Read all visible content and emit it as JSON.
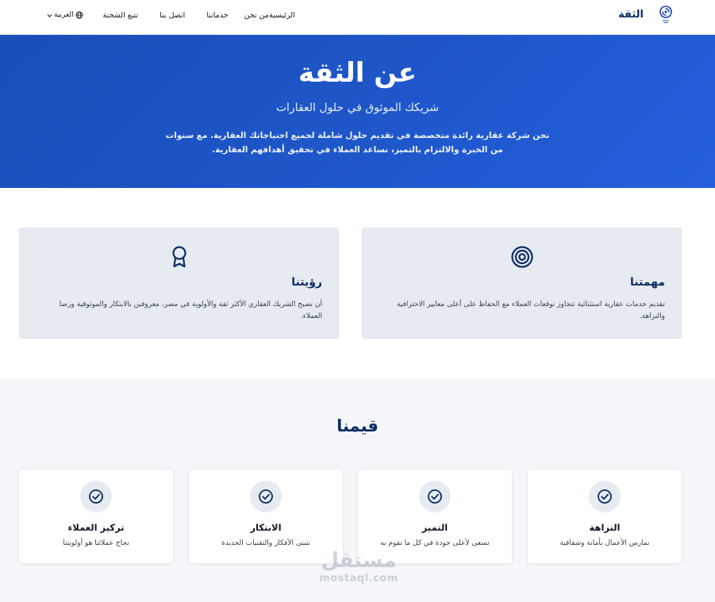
{
  "nav": {
    "brand_name": "الثقة",
    "logo_icon": "swirl-logo-icon",
    "language_label": "العربية",
    "links": {
      "home": "الرئيسية",
      "about": "من نحن",
      "services": "خدماتنا",
      "contact": "اتصل بنا",
      "tracking": "تتبع الشحنة"
    }
  },
  "hero": {
    "title": "عن الثقة",
    "subtitle": "شريكك الموثوق في حلول العقارات",
    "description": "نحن شركة عقارية رائدة متخصصة في تقديم حلول شاملة لجميع احتياجاتك العقارية. مع سنوات من الخبرة والالتزام بالتميز، نساعد العملاء في تحقيق أهدافهم العقارية."
  },
  "mission": {
    "icon": "target-icon",
    "title": "مهمتنا",
    "text": "تقديم خدمات عقارية استثنائية تتجاوز توقعات العملاء مع الحفاظ على أعلى معايير الاحترافية والنزاهة."
  },
  "vision": {
    "icon": "award-ribbon-icon",
    "title": "رؤيتنا",
    "text": "أن نصبح الشريك العقاري الأكثر ثقة والأولوية في مصر، معروفين بالابتكار والموثوقية ورضا العملاء."
  },
  "values": {
    "title": "قيمنا",
    "icon": "check-circle-icon",
    "items": [
      {
        "title": "النزاهة",
        "desc": "نمارس الأعمال بأمانة وشفافية"
      },
      {
        "title": "التميز",
        "desc": "نسعى لأعلى جودة في كل ما نقوم به"
      },
      {
        "title": "الابتكار",
        "desc": "نتبنى الأفكار والتقنيات الجديدة"
      },
      {
        "title": "تركيز العملاء",
        "desc": "نجاح عملائنا هو أولويتنا"
      }
    ]
  },
  "watermark": {
    "arabic": "مستقل",
    "latin": "mostaql.com"
  },
  "colors": {
    "primary_dark": "#0b2d63",
    "hero_start": "#1a4eb8",
    "hero_end": "#245fdb",
    "card_bg": "#e6ebf2",
    "section_bg": "#f5f7fa"
  }
}
